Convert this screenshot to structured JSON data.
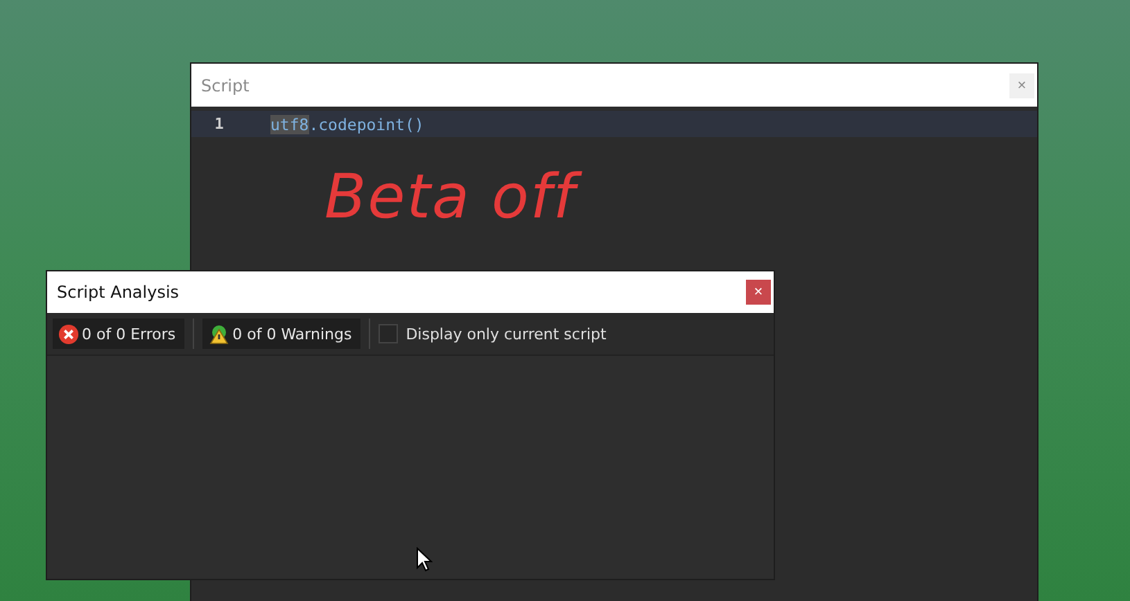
{
  "script_window": {
    "title": "Script",
    "close": "×",
    "lines": [
      {
        "number": "1",
        "selected_token": "utf8",
        "rest": ".codepoint()",
        "highlighted": true
      }
    ],
    "annotation": "Beta off"
  },
  "analysis_window": {
    "title": "Script Analysis",
    "close": "×",
    "errors": "0 of 0 Errors",
    "warnings": "0 of 0 Warnings",
    "filter": {
      "label": "Display only current script",
      "checked": false
    }
  }
}
